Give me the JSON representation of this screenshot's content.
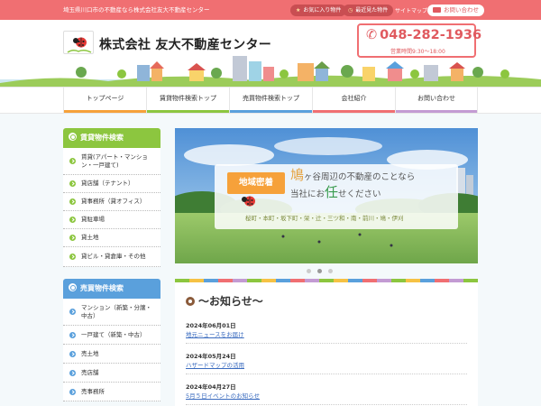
{
  "topbar": {
    "tagline": "埼玉県川口市の不動産なら株式会社友大不動産センター",
    "favorites_label": "お気に入り物件",
    "recent_label": "最近見た物件",
    "sitemap_label": "サイトマップ",
    "contact_label": "お問い合わせ"
  },
  "header": {
    "company_name": "株式会社 友大不動産センター",
    "phone": "048-282-1936",
    "hours": "営業時間9:30〜18:00"
  },
  "nav": {
    "items": [
      {
        "label": "トップページ",
        "color": "#f6a13a"
      },
      {
        "label": "賃貸物件検索トップ",
        "color": "#8cc63f"
      },
      {
        "label": "売買物件検索トップ",
        "color": "#5aa0dc"
      },
      {
        "label": "会社紹介",
        "color": "#f06f72"
      },
      {
        "label": "お問い合わせ",
        "color": "#c39bd3"
      }
    ]
  },
  "sidebar": {
    "rental": {
      "title": "賃貸物件検索",
      "items": [
        "賃貸(アパート・マンション・一戸建て)",
        "貸店舗（テナント）",
        "貸事務所（貸オフィス）",
        "貸駐車場",
        "貸土地",
        "貸ビル・貸倉庫・その他"
      ]
    },
    "sale": {
      "title": "売買物件検索",
      "items": [
        "マンション（新築・分譲・中古）",
        "一戸建て（新築・中古）",
        "売土地",
        "売店舗",
        "売事務所"
      ]
    }
  },
  "hero": {
    "badge": "地域密着",
    "big1": "鳩",
    "line1": "ヶ谷周辺の不動産のことなら",
    "line2a": "当社にお",
    "big2": "任",
    "line2b": "せください",
    "sub": "桜町・本町・坂下町・栄・辻・三ツ和・南・前川・鳩・伊刈",
    "active_slide": 2
  },
  "news": {
    "title": "〜お知らせ〜",
    "items": [
      {
        "date": "2024年06月01日",
        "title": "地元ニュースをお届け"
      },
      {
        "date": "2024年05月24日",
        "title": "ハザードマップの活用"
      },
      {
        "date": "2024年04月27日",
        "title": "5月５日イベントのお知らせ"
      }
    ]
  },
  "colors": {
    "accent_red": "#f06f72",
    "green": "#8cc63f",
    "blue": "#5aa0dc",
    "orange": "#f6a13a"
  }
}
